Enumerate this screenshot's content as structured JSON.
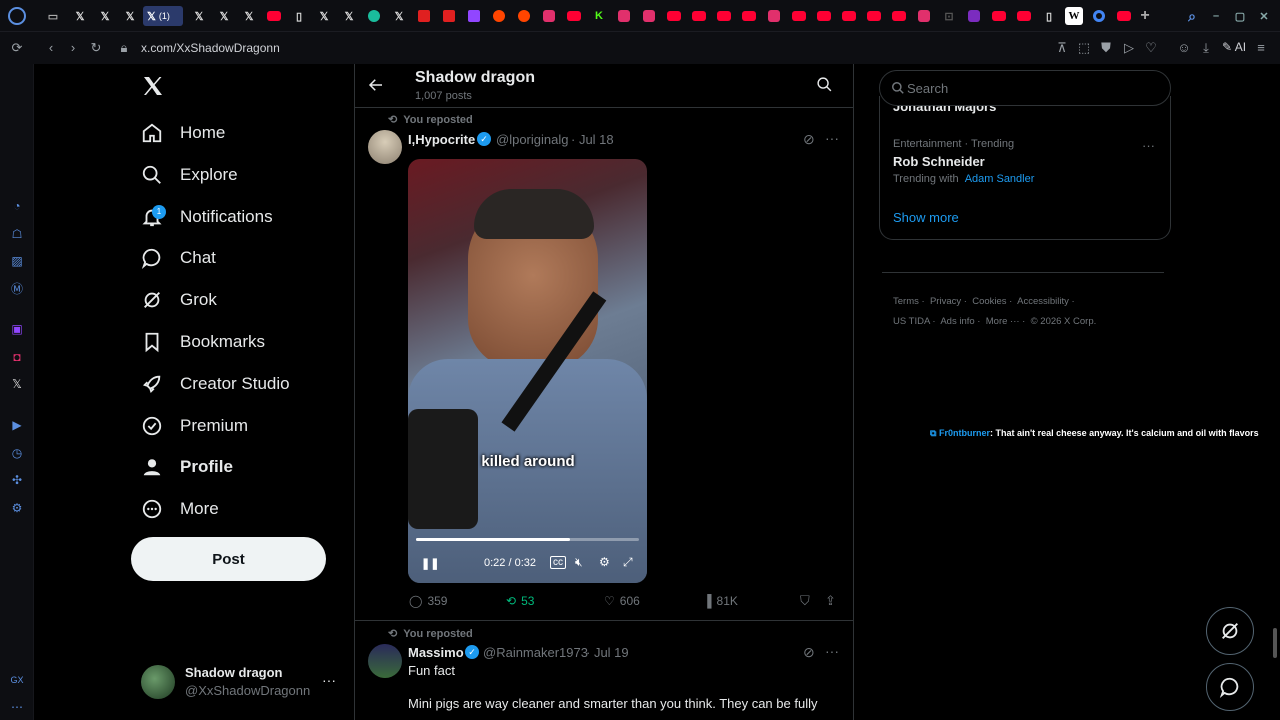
{
  "browser": {
    "url": "x.com/XxShadowDragonn",
    "active_tab_count": "(1)",
    "ai_label": "AI"
  },
  "nav": {
    "items": [
      {
        "label": "Home"
      },
      {
        "label": "Explore"
      },
      {
        "label": "Notifications",
        "badge": "1"
      },
      {
        "label": "Chat"
      },
      {
        "label": "Grok"
      },
      {
        "label": "Bookmarks"
      },
      {
        "label": "Creator Studio"
      },
      {
        "label": "Premium"
      },
      {
        "label": "Profile"
      },
      {
        "label": "More"
      }
    ],
    "post_label": "Post",
    "account": {
      "name": "Shadow dragon",
      "handle": "@XxShadowDragonn"
    }
  },
  "header": {
    "title": "Shadow dragon",
    "subtitle": "1,007 posts"
  },
  "tweets": [
    {
      "repost_label": "You reposted",
      "name": "I,Hypocrite",
      "handle": "@lporiginalg",
      "date": "· Jul 18",
      "video": {
        "caption": "killed around",
        "time": "0:22 / 0:32",
        "progress": 0.69
      },
      "replies": "359",
      "reposts": "53",
      "likes": "606",
      "views": "81K"
    },
    {
      "repost_label": "You reposted",
      "name": "Massimo",
      "handle": "@Rainmaker1973",
      "date": "· Jul 19",
      "text1": "Fun fact",
      "text2": "Mini pigs are way cleaner and smarter than you think. They can be fully"
    }
  ],
  "right": {
    "search_placeholder": "Search",
    "partial_trend": "Jonathan Majors",
    "trend": {
      "context": "Entertainment · Trending",
      "name": "Rob Schneider",
      "with_label": "Trending with",
      "with_link": "Adam Sandler"
    },
    "show_more": "Show more",
    "footer": [
      "Terms",
      "Privacy",
      "Cookies",
      "Accessibility",
      "US TIDA",
      "Ads info",
      "More ···",
      "© 2026 X Corp."
    ]
  },
  "ticker": {
    "user": "Fr0ntburner",
    "text": ": That ain't real cheese anyway. It's calcium and oil with flavors"
  },
  "colors": {
    "accent": "#1d9bf0",
    "repost_green": "#00ba7c",
    "muted": "#71767b",
    "border": "#2f3336"
  }
}
